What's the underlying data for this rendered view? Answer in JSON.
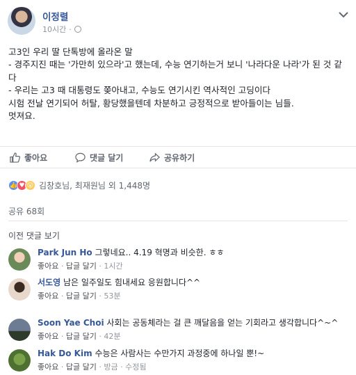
{
  "post": {
    "author": "이정렬",
    "time": "10시간",
    "lines": [
      "고3인 우리 딸 단톡방에 올라온 말",
      "- 경주지진 때는 '가만히 있으라'고 했는데, 수능 연기하는거 보니 '나라다운 나라'가 된 것 같다",
      "- 우리는 고3 때 대통령도 쫒아내고, 수능도 연기시킨 역사적인 고딩이다",
      "시험 전날 연기되어 허탈, 황당했을텐데 차분하고 긍정적으로 받아들이는 님들.",
      "멋져요."
    ]
  },
  "actions": {
    "like": "좋아요",
    "comment": "댓글 달기",
    "share": "공유하기"
  },
  "reactions": {
    "summary": "김창호님, 최재원님 외 1,448명"
  },
  "shares": "공유 68회",
  "previous_comments": "이전 댓글 보기",
  "comments": [
    {
      "name": "Park Jun Ho",
      "text": "그렇네요.. 4.19 혁명과 비슷한. ㅎㅎ",
      "like": "좋아요",
      "reply": "답글 달기",
      "time": "1시간"
    },
    {
      "name": "서도영",
      "text": "남은 일주일도 힘내세요 응원합니다^^",
      "like": "좋아요",
      "reply": "답글 달기",
      "time": "53분"
    },
    {
      "name": "Soon Yae Choi",
      "text": "사회는 공동체라는 걸 큰 깨달음을 얻는 기회라고 생각합니다^~^",
      "like": "좋아요",
      "reply": "답글 달기",
      "time": "42분"
    },
    {
      "name": "Hak Do Kim",
      "text": "수능은 사람사는 수만가지 과정중에 하나일 뿐!~",
      "like": "좋아요",
      "reply": "답글 달기",
      "time": "방금",
      "edited": "수정됨"
    }
  ],
  "colors": {
    "link_blue": "#365899",
    "text": "#1d2129",
    "meta_gray": "#90949c"
  }
}
